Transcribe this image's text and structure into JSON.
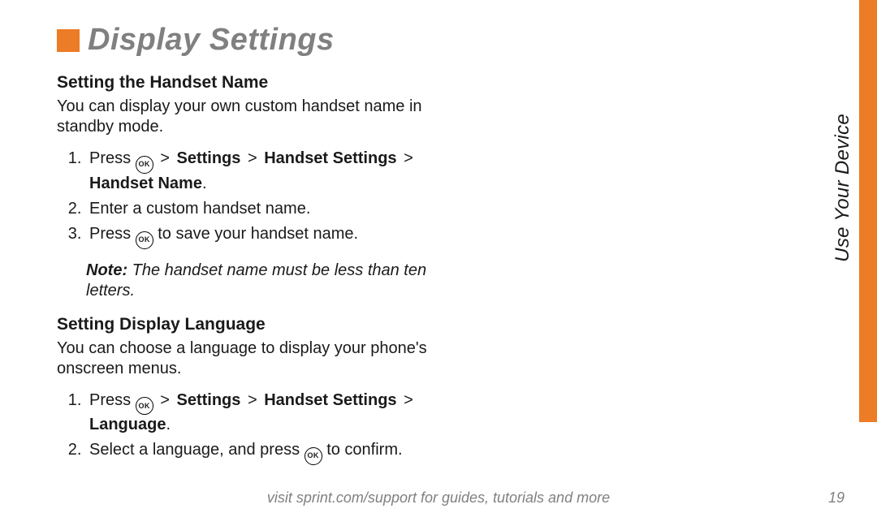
{
  "title": "Display Settings",
  "section1": {
    "heading": "Setting the Handset Name",
    "intro": "You can display your own custom handset name in standby mode.",
    "step1_pre": "Press ",
    "step1_ok": "OK",
    "step1_mid": " > ",
    "step1_path_a": "Settings",
    "step1_path_b": "Handset Settings",
    "step1_path_c": "Handset Name",
    "step1_end": ".",
    "step2": "Enter a custom handset name.",
    "step3_pre": "Press ",
    "step3_ok": "OK",
    "step3_post": " to save your handset name.",
    "note_label": "Note:",
    "note_text": " The handset name must be less than ten letters."
  },
  "section2": {
    "heading": "Setting Display Language",
    "intro": "You can choose a language to display your phone's onscreen menus.",
    "step1_pre": "Press ",
    "step1_ok": "OK",
    "step1_mid": " > ",
    "step1_path_a": "Settings",
    "step1_path_b": "Handset Settings",
    "step1_path_c": "Language",
    "step1_end": ".",
    "step2_pre": "Select a language, and press ",
    "step2_ok": "OK",
    "step2_post": " to confirm."
  },
  "side_tab": "Use Your Device",
  "footer": "visit sprint.com/support for guides, tutorials and more",
  "page_num": "19"
}
